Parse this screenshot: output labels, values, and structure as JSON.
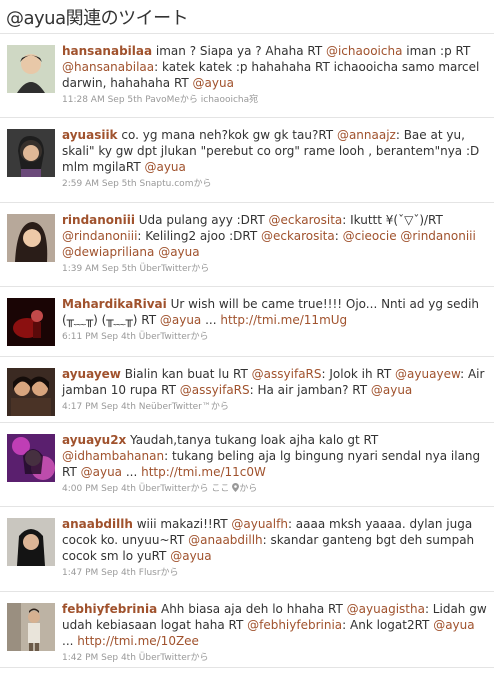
{
  "page_title": "@ayua関連のツイート",
  "colors": {
    "link": "#a0522d",
    "meta": "#999999",
    "divider": "#e4e4e4"
  },
  "tweets": [
    {
      "user": "hansanabilaa",
      "segments": [
        {
          "t": " iman ? Siapa ya ? Ahaha RT "
        },
        {
          "m": "@ichaooicha"
        },
        {
          "t": " iman :p RT "
        },
        {
          "m": "@hansanabilaa"
        },
        {
          "t": ": katek katek :p hahahaha RT ichaooicha samo marcel darwin, hahahaha RT "
        },
        {
          "m": "@ayua"
        }
      ],
      "time": "11:28 AM Sep 5th PavoMe",
      "from": "から",
      "extra": " ichaooicha宛"
    },
    {
      "user": "ayuasiik",
      "segments": [
        {
          "t": " co. yg mana neh?kok gw gk tau?RT "
        },
        {
          "m": "@annaajz"
        },
        {
          "t": ": Bae at yu, skali\" ky gw dpt jlukan \"perebut co org\" rame looh , berantem\"nya :D mlm mgilaRT "
        },
        {
          "m": "@ayua"
        }
      ],
      "time": "2:59 AM Sep 5th Snaptu.com",
      "from": "から",
      "extra": ""
    },
    {
      "user": "rindanoniii",
      "segments": [
        {
          "t": " Uda pulang ayy :DRT "
        },
        {
          "m": "@eckarosita"
        },
        {
          "t": ": Ikuttt ¥(ˇ▽ˇ)/RT "
        },
        {
          "m": "@rindanoniii"
        },
        {
          "t": ": Keliling2 ajoo :DRT "
        },
        {
          "m": "@eckarosita"
        },
        {
          "t": ": "
        },
        {
          "m": "@cieocie"
        },
        {
          "t": " "
        },
        {
          "m": "@rindanoniii"
        },
        {
          "t": " "
        },
        {
          "m": "@dewiapriliana"
        },
        {
          "t": " "
        },
        {
          "m": "@ayua"
        }
      ],
      "time": "1:39 AM Sep 5th ÜberTwitter",
      "from": "から",
      "extra": ""
    },
    {
      "user": "MahardikaRivai",
      "segments": [
        {
          "t": " Ur wish will be came true!!!! Ojo... Nnti ad yg sedih (╥﹏╥) (╥﹏╥) RT "
        },
        {
          "m": "@ayua"
        },
        {
          "t": " ... "
        },
        {
          "u": "http://tmi.me/11mUg"
        }
      ],
      "time": "6:11 PM Sep 4th ÜberTwitter",
      "from": "から",
      "extra": ""
    },
    {
      "user": "ayuayew",
      "segments": [
        {
          "t": " Bialin kan buat lu RT "
        },
        {
          "m": "@assyifaRS"
        },
        {
          "t": ": Jolok ih RT "
        },
        {
          "m": "@ayuayew"
        },
        {
          "t": ": Air jamban 10 rupa RT "
        },
        {
          "m": "@assyifaRS"
        },
        {
          "t": ": Ha air jamban? RT "
        },
        {
          "m": "@ayua"
        }
      ],
      "time": "4:17 PM Sep 4th NeüberTwitter™",
      "from": "から",
      "extra": ""
    },
    {
      "user": "ayuayu2x",
      "segments": [
        {
          "t": " Yaudah,tanya tukang loak ajha kalo gt RT "
        },
        {
          "m": "@idhambahanan"
        },
        {
          "t": ": tukang beling aja lg bingung nyari sendal nya ilang RT "
        },
        {
          "m": "@ayua"
        },
        {
          "t": " ... "
        },
        {
          "u": "http://tmi.me/11c0W"
        }
      ],
      "time": "4:00 PM Sep 4th ÜberTwitter",
      "from": "から",
      "extra": " ここ",
      "from2": "から"
    },
    {
      "user": "anaabdillh",
      "segments": [
        {
          "t": " wiii makazi!!RT "
        },
        {
          "m": "@ayualfh"
        },
        {
          "t": ": aaaa mksh yaaaa. dylan juga cocok ko. unyuu~RT "
        },
        {
          "m": "@anaabdillh"
        },
        {
          "t": ": skandar ganteng bgt deh sumpah cocok sm lo yuRT "
        },
        {
          "m": "@ayua"
        }
      ],
      "time": "1:47 PM Sep 4th Flusr",
      "from": "から",
      "extra": ""
    },
    {
      "user": "febhiyfebrinia",
      "segments": [
        {
          "t": " Ahh biasa aja deh lo hhaha RT "
        },
        {
          "m": "@ayuagistha"
        },
        {
          "t": ": Lidah gw udah kebiasaan logat haha RT "
        },
        {
          "m": "@febhiyfebrinia"
        },
        {
          "t": ": Ank logat2RT "
        },
        {
          "m": "@ayua"
        },
        {
          "t": " ... "
        },
        {
          "u": "http://tmi.me/10Zee"
        }
      ],
      "time": "1:42 PM Sep 4th ÜberTwitter",
      "from": "から",
      "extra": ""
    }
  ]
}
